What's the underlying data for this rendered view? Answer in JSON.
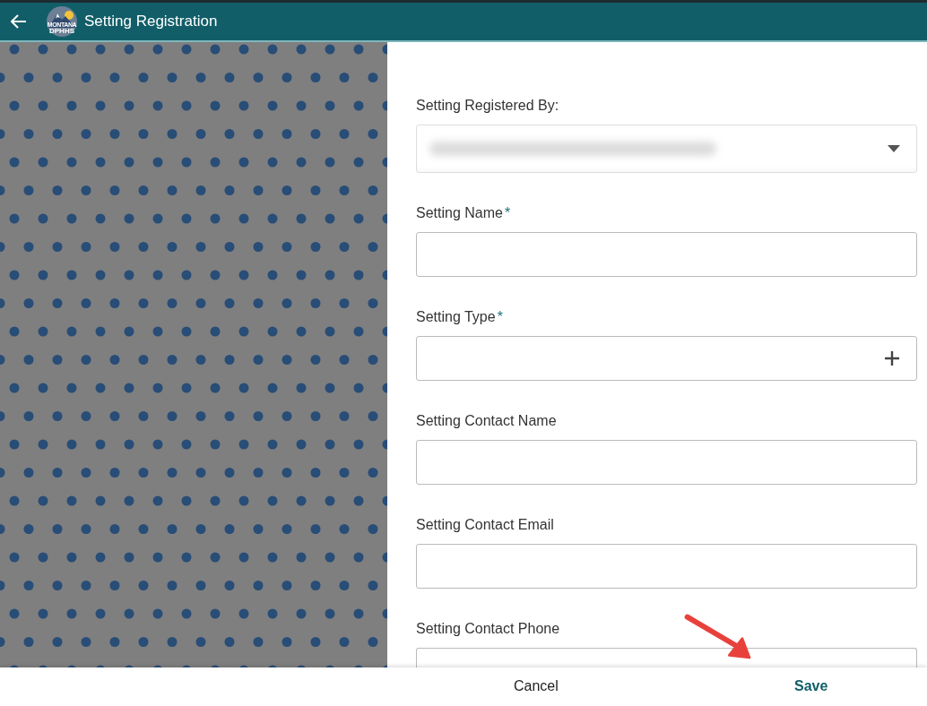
{
  "header": {
    "title": "Setting Registration",
    "logo_text": [
      "MONTANA",
      "DPHHS"
    ]
  },
  "form": {
    "required_mark": "*",
    "fields": [
      {
        "label": "Setting Registered By:",
        "kind": "dropdown",
        "required": false,
        "redacted": true
      },
      {
        "label": "Setting Name",
        "kind": "text",
        "required": true
      },
      {
        "label": "Setting Type",
        "kind": "picker",
        "required": true
      },
      {
        "label": "Setting Contact Name",
        "kind": "text",
        "required": false
      },
      {
        "label": "Setting Contact Email",
        "kind": "text",
        "required": false
      },
      {
        "label": "Setting Contact Phone",
        "kind": "text",
        "required": false
      }
    ]
  },
  "footer": {
    "buttons": [
      {
        "label": "Cancel",
        "primary": false
      },
      {
        "label": "Save",
        "primary": true
      }
    ]
  },
  "annotation": {
    "kind": "arrow"
  }
}
